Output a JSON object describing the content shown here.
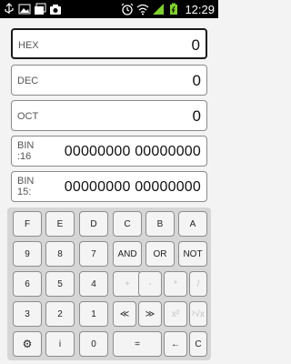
{
  "status_bar": {
    "time": "12:29",
    "icons": [
      "usb-icon",
      "image-icon",
      "gallery-icon",
      "camera-icon",
      "alarm-icon",
      "wifi-icon",
      "signal-icon",
      "battery-icon"
    ]
  },
  "displays": [
    {
      "label": "HEX",
      "value": "0"
    },
    {
      "label": "DEC",
      "value": "0"
    },
    {
      "label": "OCT",
      "value": "0"
    },
    {
      "label": "BIN\n:16",
      "value": "00000000 00000000"
    },
    {
      "label": "BIN\n15:",
      "value": "00000000 00000000"
    }
  ],
  "keys": [
    [
      "F",
      "E",
      "D",
      "C",
      "B",
      "A"
    ],
    [
      "9",
      "8",
      "7",
      "AND",
      "OR",
      "NOT"
    ],
    [
      "6",
      "5",
      "4",
      "+",
      "-",
      "*",
      "/"
    ],
    [
      "3",
      "2",
      "1",
      "≪",
      "≫",
      "x",
      "y"
    ],
    [
      "⚙",
      "i",
      "0",
      "=",
      "←",
      "C"
    ]
  ],
  "keys_row3": [
    "6",
    "5",
    "4",
    "+",
    "-",
    "*",
    "/"
  ],
  "keys_row4": [
    "3",
    "2",
    "1",
    "≪",
    "≫",
    "x²",
    "ʸ√x"
  ],
  "colors": {
    "accent_border": "#1a1a1a",
    "keypad_bg": "#d6d6d6",
    "key_disabled": "#c4c4c4"
  }
}
